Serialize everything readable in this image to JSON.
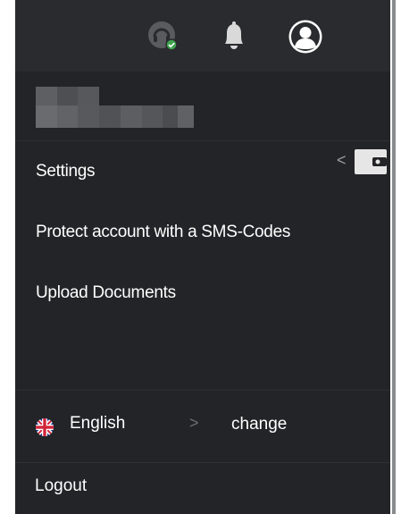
{
  "header": {
    "icons": [
      "headset-icon",
      "bell-icon",
      "user-icon"
    ],
    "support_status_color": "#3fa34d"
  },
  "menu": {
    "items": [
      {
        "label": "Settings"
      },
      {
        "label": "Protect account with a SMS-Codes"
      },
      {
        "label": "Upload Documents"
      }
    ]
  },
  "wallet_tab": {
    "icon": "wallet-icon",
    "chevron": "<"
  },
  "language": {
    "current": "English",
    "chevron": ">",
    "change_label": "change",
    "flag_icon": "uk-flag-icon"
  },
  "logout": {
    "label": "Logout"
  },
  "colors": {
    "background": "#232427",
    "header": "#2a2b2e",
    "text": "#ffffff",
    "muted": "#6d6e72"
  }
}
